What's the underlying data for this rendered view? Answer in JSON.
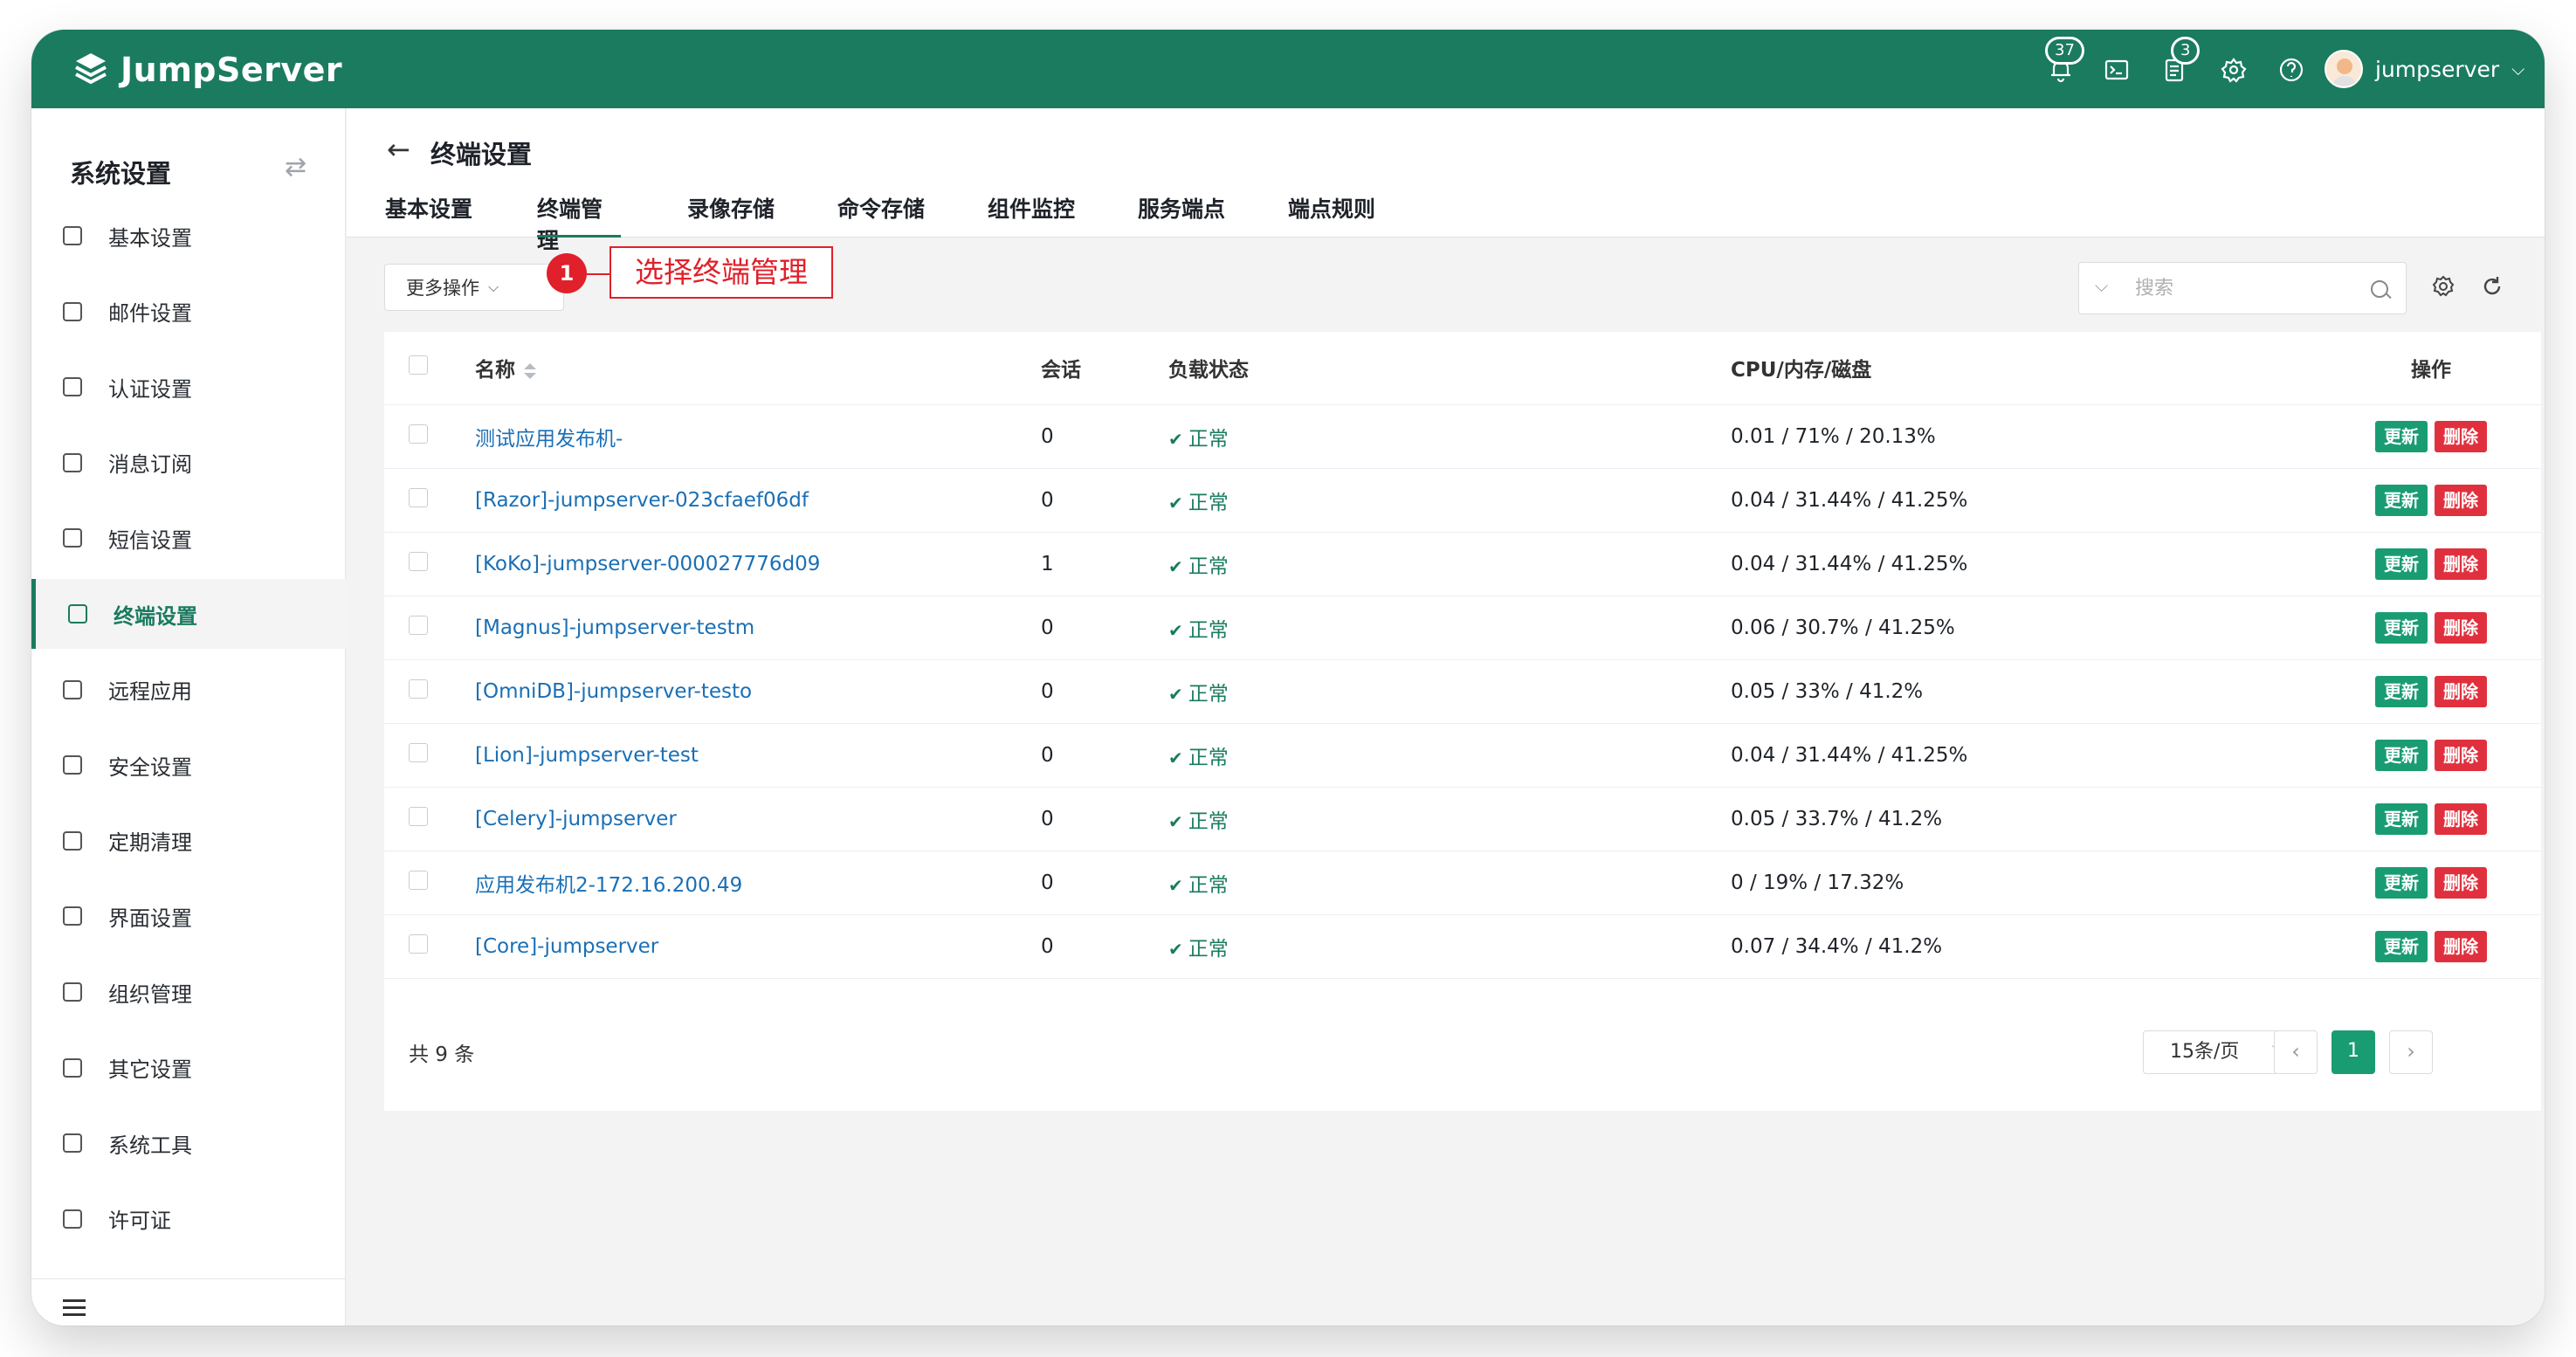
{
  "app": {
    "logo_text": "JumpServer"
  },
  "header": {
    "notification_count": "37",
    "tasks_count": "3",
    "username": "jumpserver"
  },
  "sidebar": {
    "title": "系统设置",
    "items": [
      {
        "label": "基本设置",
        "icon": "sliders-icon"
      },
      {
        "label": "邮件设置",
        "icon": "mail-icon"
      },
      {
        "label": "认证设置",
        "icon": "id-card-icon"
      },
      {
        "label": "消息订阅",
        "icon": "message-icon"
      },
      {
        "label": "短信设置",
        "icon": "sms-icon"
      },
      {
        "label": "终端设置",
        "icon": "terminal-icon",
        "active": true
      },
      {
        "label": "远程应用",
        "icon": "apps-icon"
      },
      {
        "label": "安全设置",
        "icon": "shield-icon"
      },
      {
        "label": "定期清理",
        "icon": "broom-icon"
      },
      {
        "label": "界面设置",
        "icon": "layout-icon"
      },
      {
        "label": "组织管理",
        "icon": "org-icon"
      },
      {
        "label": "其它设置",
        "icon": "circle-dot-icon"
      },
      {
        "label": "系统工具",
        "icon": "tools-icon"
      },
      {
        "label": "许可证",
        "icon": "license-icon"
      }
    ]
  },
  "page": {
    "title": "终端设置",
    "tabs": [
      "基本设置",
      "终端管理",
      "录像存储",
      "命令存储",
      "组件监控",
      "服务端点",
      "端点规则"
    ],
    "active_tab": 1
  },
  "toolbar": {
    "more_actions": "更多操作",
    "search_placeholder": "搜索"
  },
  "callout": {
    "number": "1",
    "text": "选择终端管理"
  },
  "table": {
    "columns": [
      "名称",
      "会话",
      "负载状态",
      "CPU/内存/磁盘",
      "操作"
    ],
    "rows": [
      {
        "name": "测试应用发布机-",
        "sessions": "0",
        "status": "正常",
        "stats": "0.01 / 71% / 20.13%"
      },
      {
        "name": "[Razor]-jumpserver-023cfaef06df",
        "sessions": "0",
        "status": "正常",
        "stats": "0.04 / 31.44% / 41.25%"
      },
      {
        "name": "[KoKo]-jumpserver-000027776d09",
        "sessions": "1",
        "status": "正常",
        "stats": "0.04 / 31.44% / 41.25%"
      },
      {
        "name": "[Magnus]-jumpserver-testm",
        "sessions": "0",
        "status": "正常",
        "stats": "0.06 / 30.7% / 41.25%"
      },
      {
        "name": "[OmniDB]-jumpserver-testo",
        "sessions": "0",
        "status": "正常",
        "stats": "0.05 / 33% / 41.2%"
      },
      {
        "name": "[Lion]-jumpserver-test",
        "sessions": "0",
        "status": "正常",
        "stats": "0.04 / 31.44% / 41.25%"
      },
      {
        "name": "[Celery]-jumpserver",
        "sessions": "0",
        "status": "正常",
        "stats": "0.05 / 33.7% / 41.2%"
      },
      {
        "name": "应用发布机2-172.16.200.49",
        "sessions": "0",
        "status": "正常",
        "stats": "0 / 19% / 17.32%"
      },
      {
        "name": "[Core]-jumpserver",
        "sessions": "0",
        "status": "正常",
        "stats": "0.07 / 34.4% / 41.2%"
      }
    ],
    "update_label": "更新",
    "delete_label": "删除"
  },
  "pagination": {
    "total": "共 9 条",
    "page_size": "15条/页",
    "current_page": "1",
    "prev": "‹",
    "next": "›"
  },
  "colors": {
    "brand": "#1a7b5f",
    "link": "#1a6fb5",
    "danger": "#e0303e",
    "callout": "#e0202a"
  }
}
